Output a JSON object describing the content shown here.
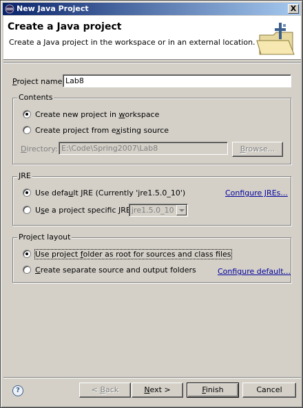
{
  "window": {
    "title": "New Java Project",
    "close_label": "X"
  },
  "banner": {
    "title": "Create a Java project",
    "description": "Create a Java project in the workspace or in an external location."
  },
  "project_name": {
    "label_pre": "",
    "label_u": "P",
    "label_post": "roject name:",
    "value": "Lab8"
  },
  "contents": {
    "title": "Contents",
    "option_new": {
      "pre": "Create new project in ",
      "u": "w",
      "post": "orkspace",
      "checked": true
    },
    "option_existing": {
      "pre": "Create project from e",
      "u": "x",
      "post": "isting source",
      "checked": false
    },
    "directory": {
      "pre": "",
      "u": "D",
      "post": "irectory:",
      "value": "E:\\Code\\Spring2007\\Lab8"
    },
    "browse": {
      "pre": "",
      "u": "B",
      "post": "rowse..."
    }
  },
  "jre": {
    "title": "JRE",
    "option_default": {
      "pre": "Use defa",
      "u": "u",
      "post": "lt JRE (Currently 'jre1.5.0_10')",
      "checked": true
    },
    "option_specific": {
      "pre": "U",
      "u": "s",
      "post": "e a project specific JRE:",
      "checked": false
    },
    "jre_select": "jre1.5.0_10",
    "configure_link": "Configure JREs..."
  },
  "project_layout": {
    "title": "Project layout",
    "option_root": {
      "pre": "Use project ",
      "u": "f",
      "post": "older as root for sources and class files",
      "checked": true
    },
    "option_separate": {
      "pre": "",
      "u": "C",
      "post": "reate separate source and output folders",
      "checked": false
    },
    "configure_link": "Configure default..."
  },
  "footer": {
    "help": "?",
    "back": {
      "pre": "< ",
      "u": "B",
      "post": "ack"
    },
    "next": {
      "pre": "",
      "u": "N",
      "post": "ext >"
    },
    "finish": {
      "pre": "",
      "u": "F",
      "post": "inish"
    },
    "cancel": "Cancel"
  }
}
